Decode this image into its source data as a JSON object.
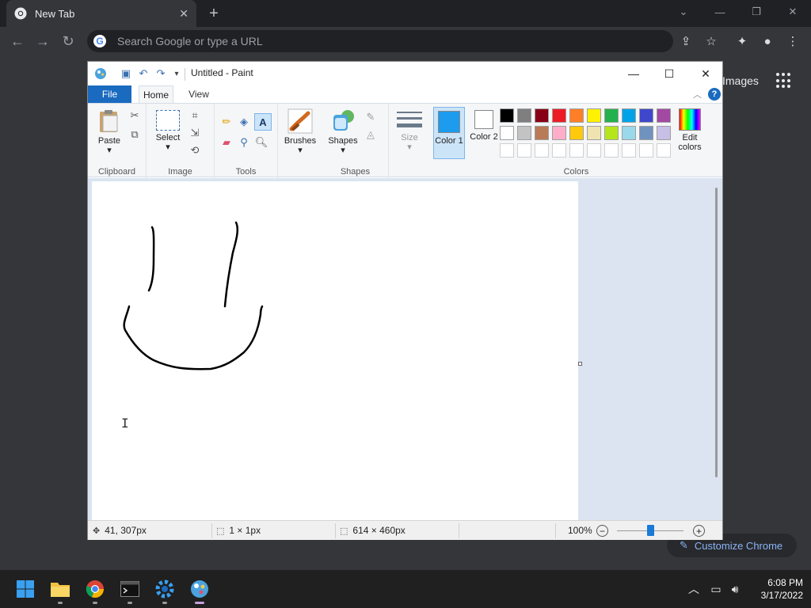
{
  "chrome": {
    "tab_title": "New Tab",
    "tab_close": "✕",
    "new_tab": "+",
    "omnibox_placeholder": "Search Google or type a URL",
    "google_g": "G",
    "images_link": "Images",
    "customize_label": "Customize Chrome"
  },
  "paint": {
    "window_title": "Untitled - Paint",
    "tabs": {
      "file": "File",
      "home": "Home",
      "view": "View"
    },
    "groups": {
      "clipboard": "Clipboard",
      "image": "Image",
      "tools": "Tools",
      "shapes": "Shapes",
      "colors": "Colors"
    },
    "buttons": {
      "paste": "Paste",
      "select": "Select",
      "brushes": "Brushes",
      "shapes": "Shapes",
      "size": "Size",
      "color1": "Color 1",
      "color2": "Color 2",
      "edit_colors": "Edit colors"
    },
    "color1_value": "#1c9bef",
    "color2_value": "#ffffff",
    "palette_row1": [
      "#000000",
      "#7f7f7f",
      "#880015",
      "#ed1c24",
      "#ff7f27",
      "#fff200",
      "#22b14c",
      "#00a2e8",
      "#3f48cc",
      "#a349a4"
    ],
    "palette_row2": [
      "#ffffff",
      "#c3c3c3",
      "#b97a57",
      "#ffaec9",
      "#ffc90e",
      "#efe4b0",
      "#b5e61d",
      "#99d9ea",
      "#7092be",
      "#c8bfe7"
    ],
    "status": {
      "cursor_pos": "41, 307px",
      "selection_size": "1 × 1px",
      "canvas_size": "614 × 460px",
      "zoom": "100%"
    },
    "zoom_fraction": 0.5
  },
  "taskbar": {
    "time": "6:08 PM",
    "date": "3/17/2022"
  }
}
